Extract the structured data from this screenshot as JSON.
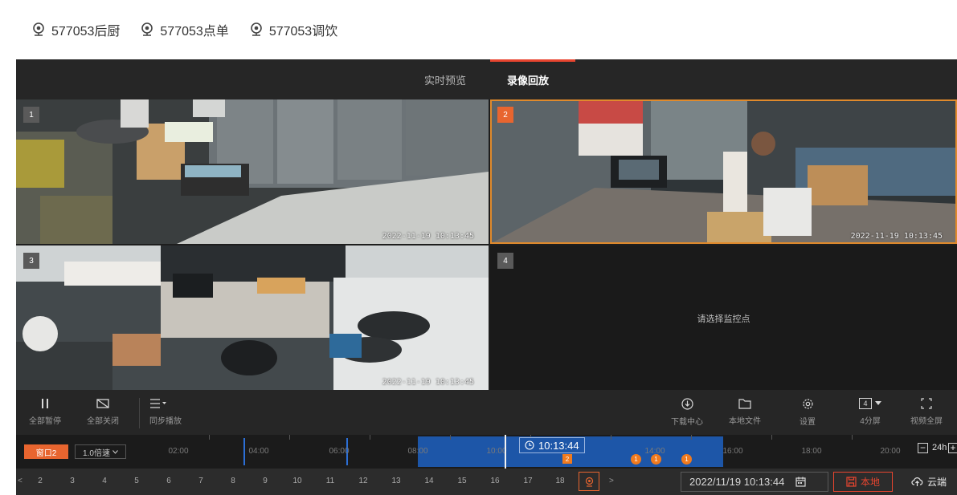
{
  "camera_tabs": [
    {
      "label": "577053后厨",
      "icon": "webcam-icon"
    },
    {
      "label": "577053点单",
      "icon": "webcam-icon"
    },
    {
      "label": "577053调饮",
      "icon": "webcam-icon"
    }
  ],
  "mode_tabs": {
    "live_label": "实时预览",
    "playback_label": "录像回放",
    "active": "playback"
  },
  "panes": [
    {
      "number": "1",
      "timestamp": "2022-11-19 10:13:45",
      "selected": false
    },
    {
      "number": "2",
      "timestamp": "2022-11-19 10:13:45",
      "selected": true
    },
    {
      "number": "3",
      "timestamp": "2022-11-19 10:13:45",
      "selected": false
    },
    {
      "number": "4",
      "empty_text": "请选择监控点",
      "selected": false
    }
  ],
  "controls": {
    "pause_all": "全部暂停",
    "close_all": "全部关闭",
    "sync_play": "同步播放",
    "download_center": "下载中心",
    "local_files": "本地文件",
    "settings": "设置",
    "layout_value": "4",
    "layout_label": "4分屏",
    "fullscreen": "视频全屏"
  },
  "timeline": {
    "window_label": "窗口2",
    "speed_label": "1.0倍速",
    "hours": [
      "02:00",
      "04:00",
      "06:00",
      "08:00",
      "10:00",
      "14:00",
      "16:00",
      "18:00",
      "20:00"
    ],
    "current_time": "10:13:44",
    "selected_marker": "2",
    "event_markers": [
      "1",
      "1",
      "1"
    ],
    "zoom_label": "24h",
    "zoom_out": "−",
    "zoom_in": "+"
  },
  "pagination": {
    "prev": "<",
    "pages": [
      "2",
      "3",
      "4",
      "5",
      "6",
      "7",
      "8",
      "9",
      "10",
      "11",
      "12",
      "13",
      "14",
      "15",
      "16",
      "17",
      "18"
    ],
    "next": ">"
  },
  "date_field": {
    "value": "2022/11/19 10:13:44"
  },
  "storage": {
    "local_label": "本地",
    "cloud_label": "云端"
  },
  "colors": {
    "accent": "#e8652f",
    "timeline_blue": "#1d56a8",
    "dark_bg": "#1e1e1e"
  }
}
